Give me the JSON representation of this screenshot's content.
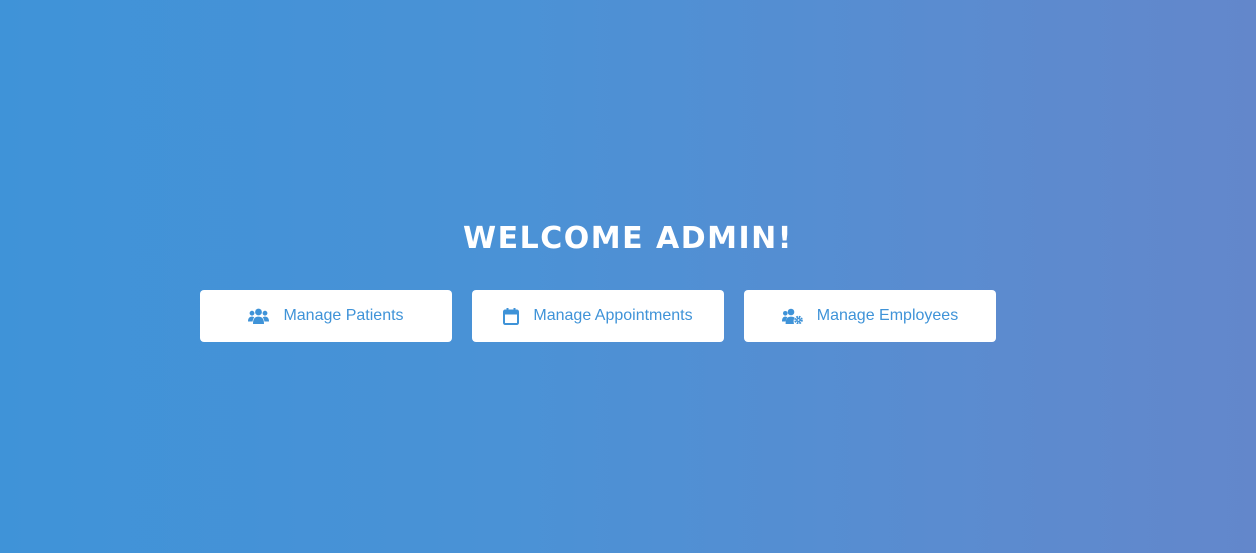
{
  "heading": "WELCOME ADMIN!",
  "colors": {
    "accent": "#3f93d8",
    "button_bg": "#ffffff",
    "gradient_start": "#3f93d8",
    "gradient_end": "#6387cb"
  },
  "actions": [
    {
      "label": "Manage Patients",
      "icon": "users-icon"
    },
    {
      "label": "Manage Appointments",
      "icon": "calendar-icon"
    },
    {
      "label": "Manage Employees",
      "icon": "users-cog-icon"
    }
  ]
}
